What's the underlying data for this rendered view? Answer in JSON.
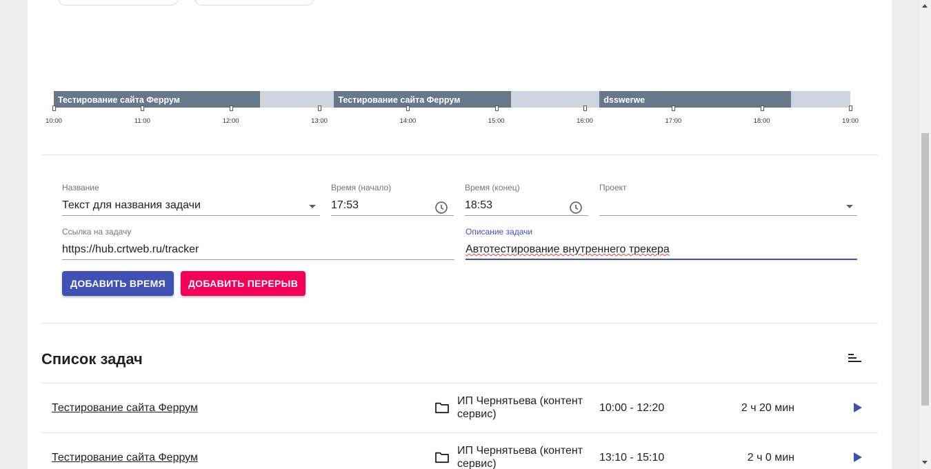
{
  "timeline": {
    "segments": [
      {
        "label": "Тестирование сайта Феррум",
        "start": "10:00",
        "end": "12:20"
      },
      {
        "label": "Тестирование сайта Феррум",
        "start": "13:10",
        "end": "15:10"
      },
      {
        "label": "dsswerwe",
        "start": "16:10",
        "end": "18:20"
      }
    ],
    "ticks": [
      "10:00",
      "11:00",
      "12:00",
      "13:00",
      "14:00",
      "15:00",
      "16:00",
      "17:00",
      "18:00",
      "19:00"
    ]
  },
  "form": {
    "name": {
      "label": "Название",
      "value": "Текст для названия задачи"
    },
    "start_time": {
      "label": "Время (начало)",
      "value": "17:53"
    },
    "end_time": {
      "label": "Время (конец)",
      "value": "18:53"
    },
    "project": {
      "label": "Проект",
      "value": ""
    },
    "link": {
      "label": "Ссылка на задачу",
      "value": "https://hub.crtweb.ru/tracker"
    },
    "description": {
      "label": "Описание задачи",
      "value": "Автотестирование внутреннего трекера"
    },
    "add_time_button": "ДОБАВИТЬ ВРЕМЯ",
    "add_break_button": "ДОБАВИТЬ ПЕРЕРЫВ"
  },
  "task_list": {
    "title": "Список задач",
    "rows": [
      {
        "task": "Тестирование сайта Феррум",
        "project": "ИП Чернятьева (контент сервис)",
        "time": "10:00 - 12:20",
        "duration": "2 ч 20 мин"
      },
      {
        "task": "Тестирование сайта Феррум",
        "project": "ИП Чернятьева (контент сервис)",
        "time": "13:10 - 15:10",
        "duration": "2 ч 0 мин"
      }
    ]
  },
  "colors": {
    "primary": "#3f51b5",
    "accent": "#f50057",
    "segment": "#67788b",
    "track": "#d0d5dd"
  },
  "icons": [
    "clock-icon",
    "dropdown-arrow-icon",
    "sort-icon",
    "folder-icon",
    "play-icon"
  ]
}
